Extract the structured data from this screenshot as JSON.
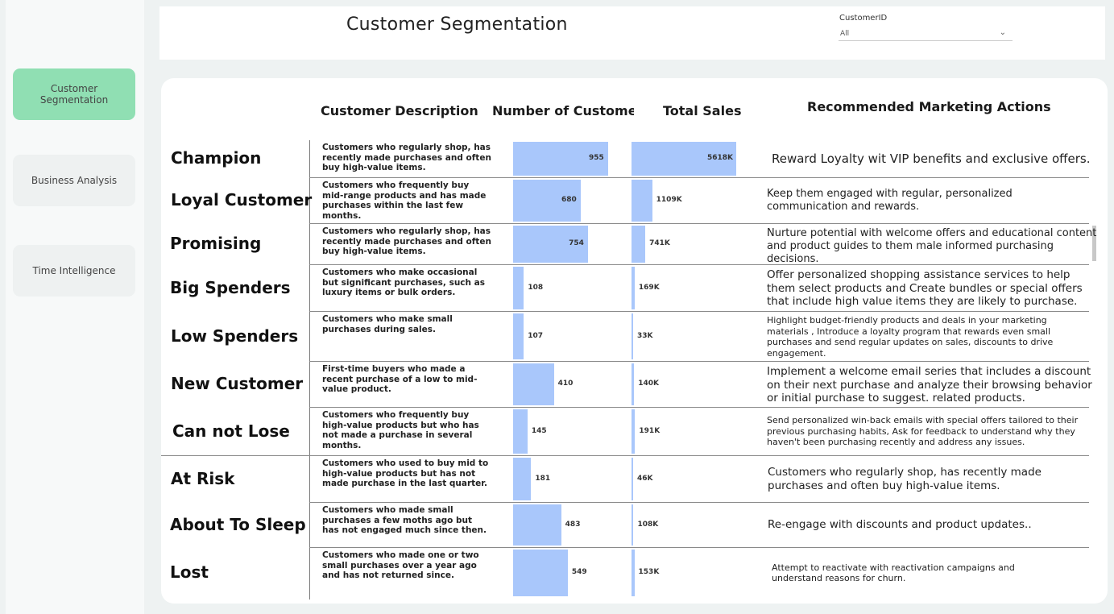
{
  "sidebar": {
    "items": [
      {
        "label": "Customer\nSegmentation",
        "active": true
      },
      {
        "label": "Business Analysis",
        "active": false
      },
      {
        "label": "Time Intelligence",
        "active": false
      }
    ]
  },
  "header": {
    "title": "Customer Segmentation",
    "filter_label": "CustomerID",
    "filter_value": "All"
  },
  "table": {
    "headers": [
      "Customer Description",
      "Number of Customers",
      "Total Sales",
      "Recommended Marketing Actions"
    ],
    "rows": [
      {
        "segment": "Champion",
        "description": "Customers who regularly shop, has recently made purchases and often buy high-value items.",
        "customers": 955,
        "customers_label": "955",
        "sales": 5618,
        "sales_label": "5618K",
        "action": "Reward Loyalty wit VIP benefits and exclusive offers."
      },
      {
        "segment": "Loyal Customer",
        "description": "Customers who frequently buy mid-range products and has made purchases within the last few months.",
        "customers": 680,
        "customers_label": "680",
        "sales": 1109,
        "sales_label": "1109K",
        "action": "Keep them engaged with regular, personalized communication and rewards."
      },
      {
        "segment": "Promising",
        "description": "Customers who regularly shop, has recently made purchases and often buy high-value items.",
        "customers": 754,
        "customers_label": "754",
        "sales": 741,
        "sales_label": "741K",
        "action": "Nurture potential with welcome offers and educational content and product guides to them male informed purchasing decisions."
      },
      {
        "segment": "Big Spenders",
        "description": "Customers who make occasional but significant purchases, such as luxury items or bulk orders.",
        "customers": 108,
        "customers_label": "108",
        "sales": 169,
        "sales_label": "169K",
        "action": "Offer personalized shopping assistance services to help them select products and Create bundles or special offers that include high value items they are likely to purchase."
      },
      {
        "segment": "Low Spenders",
        "description": "Customers who make small purchases during sales.",
        "customers": 107,
        "customers_label": "107",
        "sales": 33,
        "sales_label": "33K",
        "action": "Highlight budget-friendly products and deals in your marketing materials , Introduce a loyalty program that rewards even small purchases and send regular updates on sales, discounts to drive engagement."
      },
      {
        "segment": "New Customer",
        "description": "First-time buyers who made a recent purchase of a low to mid-value product.",
        "customers": 410,
        "customers_label": "410",
        "sales": 140,
        "sales_label": "140K",
        "action": "Implement a welcome email series that includes a discount on their next purchase and analyze their browsing behavior or initial purchase to suggest. related products."
      },
      {
        "segment": "Can not Lose",
        "description": "Customers who frequently buy high-value products but who has not made a purchase in several months.",
        "customers": 145,
        "customers_label": "145",
        "sales": 191,
        "sales_label": "191K",
        "action": "Send personalized win-back emails with special offers tailored to their previous purchasing habits, Ask for feedback to understand why they haven't been purchasing recently and address any issues."
      },
      {
        "segment": "At Risk",
        "description": "Customers who used to buy mid to high-value products but has not made purchase in the last quarter.",
        "customers": 181,
        "customers_label": "181",
        "sales": 46,
        "sales_label": "46K",
        "action": "Customers who regularly shop, has recently made purchases and often buy high-value items."
      },
      {
        "segment": "About To Sleep",
        "description": "Customers who made small purchases a few moths ago but has not engaged much since then.",
        "customers": 483,
        "customers_label": "483",
        "sales": 108,
        "sales_label": "108K",
        "action": "Re-engage with discounts and product updates.."
      },
      {
        "segment": "Lost",
        "description": "Customers who made one or two small purchases over a year ago and has not returned since.",
        "customers": 549,
        "customers_label": "549",
        "sales": 153,
        "sales_label": "153K",
        "action": "Attempt to reactivate with reactivation campaigns and understand reasons for churn."
      }
    ]
  },
  "colors": {
    "bar": "#a9c7fb",
    "active_nav": "#90dfb3"
  }
}
